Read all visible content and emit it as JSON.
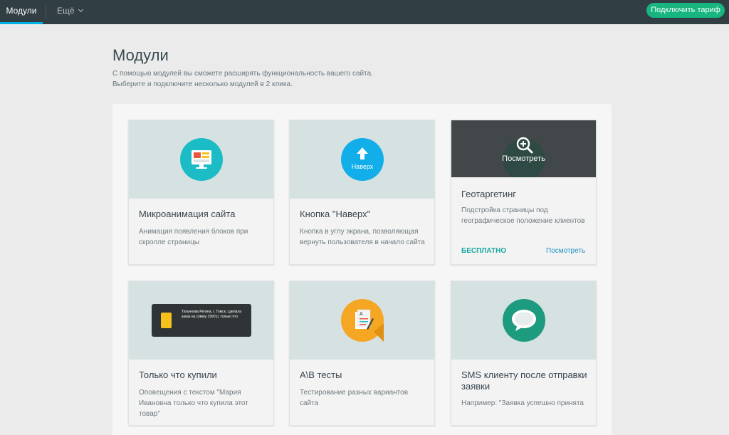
{
  "topbar": {
    "active_tab": "Модули",
    "more_tab": "Ещё",
    "upgrade_button": "Подключить тариф"
  },
  "page": {
    "title": "Модули",
    "description_line1": "С помощью модулей вы сможете расширять функциональность вашего сайта.",
    "description_line2": "Выберите и подключите несколько модулей в 2 клика."
  },
  "cards": [
    {
      "title": "Микроанимация сайта",
      "description": "Анимация появления блоков при скролле страницы",
      "icon": "monitor-icon",
      "icon_color": "#1bbcc6"
    },
    {
      "title": "Кнопка \"Наверх\"",
      "description": "Кнопка в углу экрана, позволяющая вернуть пользователя в начало сайта",
      "icon": "arrow-up-icon",
      "icon_label": "Наверх",
      "icon_color": "#11aee9"
    },
    {
      "title": "Геотаргетинг",
      "description": "Подстройка страницы под географическое положение клиентов",
      "icon": "zoom-icon",
      "overlay_label": "Посмотреть",
      "price_label": "БЕСПЛАТНО",
      "view_link": "Посмотреть"
    },
    {
      "title": "Только что купили",
      "description": "Оповещения с текстом \"Мария Ивановна только что купила этот товар\"",
      "icon": "notification-icon",
      "notification_text": "Татьянова Регина, г. Томск, сделала заказ на сумму 1990 р, только что"
    },
    {
      "title": "A\\B тесты",
      "description": "Тестирование разных вариантов сайта",
      "icon": "ab-test-icon",
      "icon_color": "#f5a623"
    },
    {
      "title": "SMS клиенту после отправки заявки",
      "description": "Например: \"Заявка успешно принята",
      "icon": "chat-bubble-icon",
      "icon_color": "#1d9b7f"
    }
  ]
}
